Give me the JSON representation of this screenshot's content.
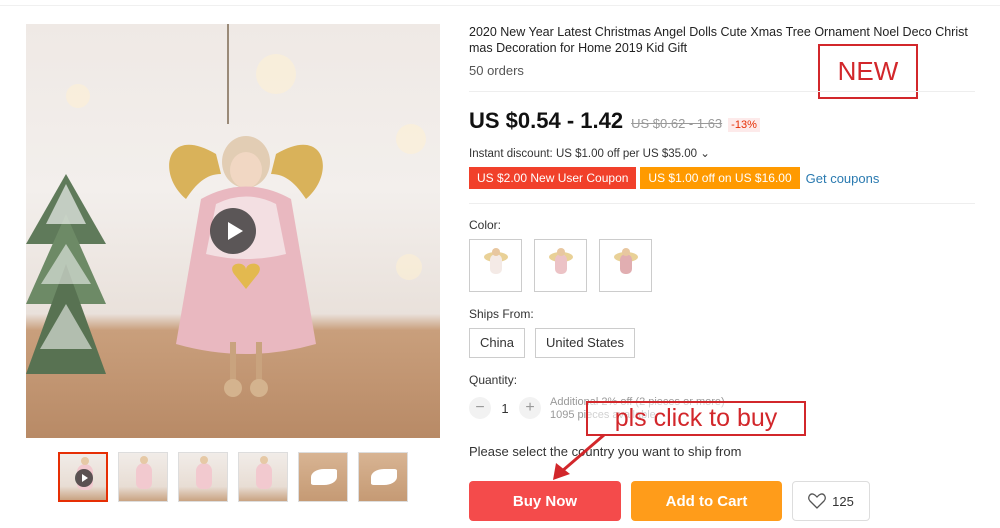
{
  "product": {
    "title": "2020 New Year Latest Christmas Angel Dolls Cute Xmas Tree Ornament Noel Deco Christmas Decoration for Home 2019 Kid Gift",
    "orders": "50 orders",
    "price": "US $0.54 - 1.42",
    "old_price": "US $0.62 - 1.63",
    "discount": "-13%",
    "instant_discount": "Instant discount: US $1.00 off per US $35.00 ⌄"
  },
  "coupons": {
    "new_user": "US $2.00 New User Coupon",
    "threshold": "US $1.00 off on US $16.00",
    "get_link": "Get coupons"
  },
  "options": {
    "color_label": "Color:",
    "ships_label": "Ships From:",
    "ships": [
      "China",
      "United States"
    ],
    "quantity_label": "Quantity:",
    "quantity": "1",
    "qty_minus": "−",
    "qty_plus": "+",
    "qty_note_1": "Additional 2% off (2 pieces or more)",
    "qty_note_2": "1095 pieces available"
  },
  "ship_message": "Please select the country you want to ship from",
  "actions": {
    "buy_now": "Buy Now",
    "add_to_cart": "Add to Cart",
    "wishlist_count": "125"
  },
  "annotations": {
    "new": "NEW",
    "click": "pls click to buy",
    "color": "#d2272b"
  },
  "colors": {
    "accent": "#f44b4b",
    "cart": "#ff9c1a",
    "coupon_red": "#f1402a",
    "coupon_orange": "#ff9a00",
    "link": "#2a7ab0"
  },
  "icons": {
    "play": "play-icon",
    "heart": "heart-icon"
  }
}
